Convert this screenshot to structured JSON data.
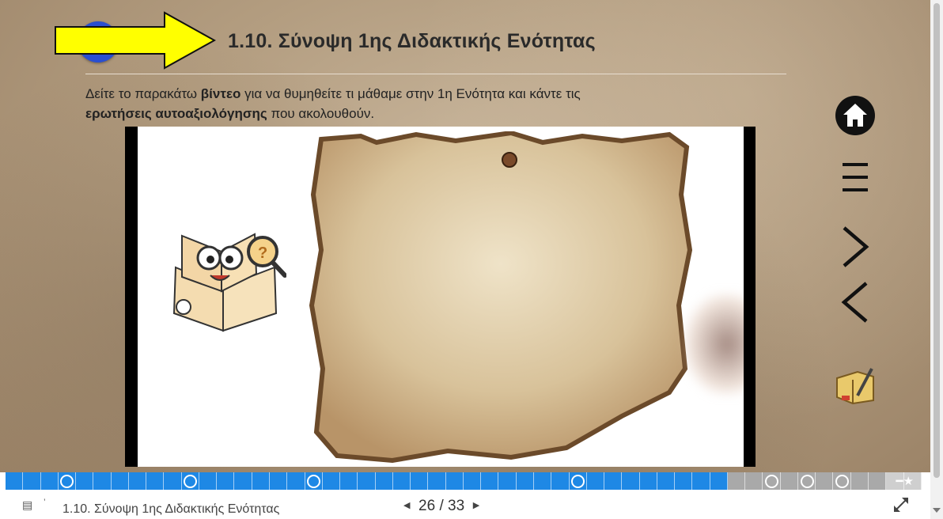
{
  "header": {
    "title": "1.10. Σύνοψη 1ης Διδακτικής Ενότητας"
  },
  "intro": {
    "part1": "Δείτε το παρακάτω ",
    "bold1": "βίντεο",
    "part2": " για να θυμηθείτε τι μάθαμε στην 1η Ενότητα και κάντε τις ",
    "bold2": "ερωτήσεις αυτοαξιολόγησης",
    "part3": " που ακολουθούν."
  },
  "side_nav": {
    "items": [
      {
        "icon": "home-icon"
      },
      {
        "icon": "menu-icon"
      },
      {
        "icon": "next-arrow-icon"
      },
      {
        "icon": "prev-arrow-icon"
      },
      {
        "icon": "notebook-icon"
      }
    ]
  },
  "progress": {
    "total": 33,
    "current": 26,
    "completed_markers": [
      4,
      11,
      18,
      33
    ],
    "viewed_markers": [
      44,
      46,
      48
    ]
  },
  "footer": {
    "title": "1.10. Σύνοψη 1ης Διδακτικής Ενότητας",
    "current_page": "26",
    "separator": "/",
    "total_pages": "33",
    "prev_symbol": "◀",
    "next_symbol": "▶"
  },
  "colors": {
    "accent": "#1e88e5",
    "arrow_fill": "#ffff00",
    "dot": "#2a4fd0"
  }
}
